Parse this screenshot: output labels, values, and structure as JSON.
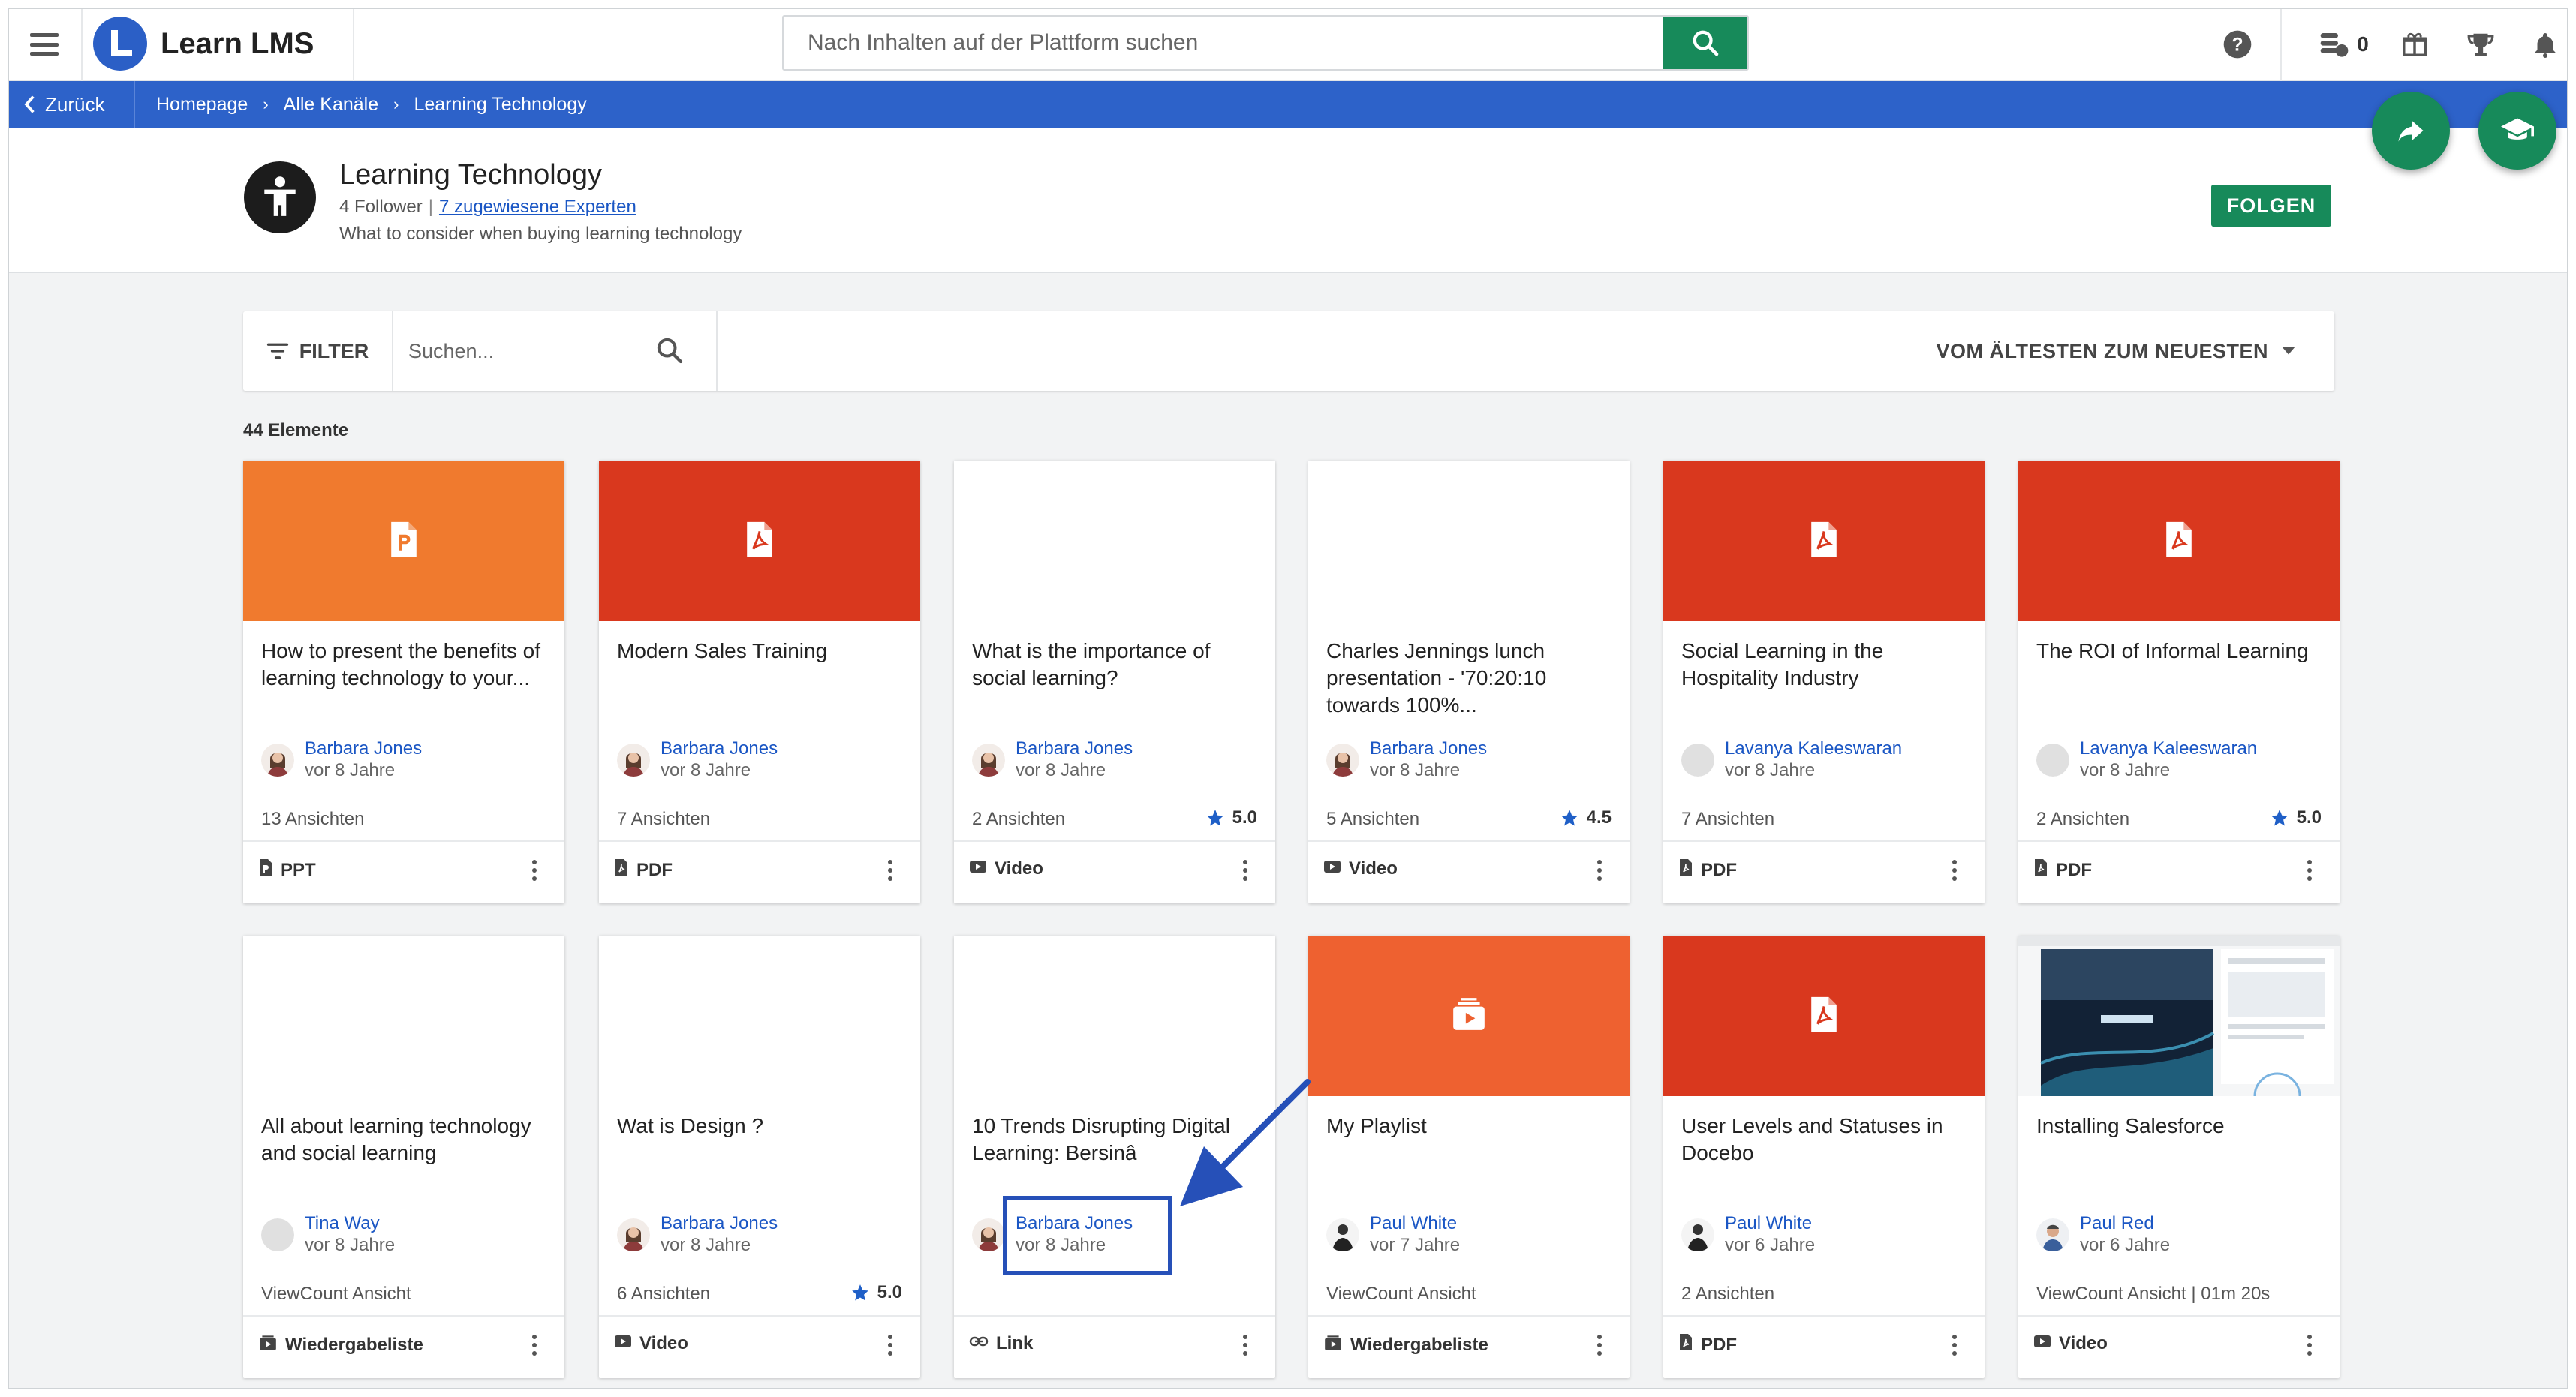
{
  "app": {
    "name": "Learn LMS",
    "brand_color": "#2b5fc6",
    "accent_color": "#178a5a"
  },
  "topbar": {
    "search_placeholder": "Nach Inhalten auf der Plattform suchen",
    "coins_count": "0",
    "icons": [
      "menu-icon",
      "search-icon",
      "help-icon",
      "coins-icon",
      "gift-icon",
      "trophy-icon",
      "bell-icon"
    ]
  },
  "breadcrumb": {
    "back_label": "Zurück",
    "items": [
      "Homepage",
      "Alle Kanäle",
      "Learning Technology"
    ]
  },
  "channel": {
    "title": "Learning Technology",
    "followers": "4 Follower",
    "experts": "7 zugewiesene Experten",
    "description": "What to consider when buying learning technology",
    "follow_label": "FOLGEN"
  },
  "toolbar": {
    "filter_label": "FILTER",
    "search_placeholder": "Suchen...",
    "sort_label": "VOM ÄLTESTEN ZUM NEUESTEN"
  },
  "count_label": "44 Elemente",
  "cards": [
    {
      "title": "How to present the benefits of learning technology to your...",
      "author": "Barbara Jones",
      "date": "vor 8 Jahre",
      "views": "13 Ansichten",
      "rating": "",
      "type": "PPT",
      "thumb": "ppt",
      "color": "#f07a2e"
    },
    {
      "title": "Modern Sales Training",
      "author": "Barbara Jones",
      "date": "vor 8 Jahre",
      "views": "7 Ansichten",
      "rating": "",
      "type": "PDF",
      "thumb": "pdf",
      "color": "#d9381e"
    },
    {
      "title": "What is the importance of social learning?",
      "author": "Barbara Jones",
      "date": "vor 8 Jahre",
      "views": "2 Ansichten",
      "rating": "5.0",
      "type": "Video",
      "thumb": "blank",
      "color": "#ffffff"
    },
    {
      "title": "Charles Jennings lunch presentation - '70:20:10 towards 100%...",
      "author": "Barbara Jones",
      "date": "vor 8 Jahre",
      "views": "5 Ansichten",
      "rating": "4.5",
      "type": "Video",
      "thumb": "blank",
      "color": "#ffffff"
    },
    {
      "title": "Social Learning in the Hospitality Industry",
      "author": "Lavanya Kaleeswaran",
      "date": "vor 8 Jahre",
      "views": "7 Ansichten",
      "rating": "",
      "type": "PDF",
      "thumb": "pdf",
      "color": "#d9381e"
    },
    {
      "title": "The ROI of Informal Learning",
      "author": "Lavanya Kaleeswaran",
      "date": "vor 8 Jahre",
      "views": "2 Ansichten",
      "rating": "5.0",
      "type": "PDF",
      "thumb": "pdf",
      "color": "#d9381e"
    },
    {
      "title": "All about learning technology and social learning",
      "author": "Tina Way",
      "date": "vor 8 Jahre",
      "views": "ViewCount Ansicht",
      "rating": "",
      "type": "Wiedergabeliste",
      "thumb": "blank",
      "color": "#ffffff"
    },
    {
      "title": "Wat is Design ?",
      "author": "Barbara Jones",
      "date": "vor 8 Jahre",
      "views": "6 Ansichten",
      "rating": "5.0",
      "type": "Video",
      "thumb": "blank",
      "color": "#ffffff"
    },
    {
      "title": "10 Trends Disrupting Digital Learning: Bersinâ",
      "author": "Barbara Jones",
      "date": "vor 8 Jahre",
      "views": "",
      "rating": "",
      "type": "Link",
      "thumb": "blank",
      "color": "#ffffff"
    },
    {
      "title": "My Playlist",
      "author": "Paul White",
      "date": "vor 7 Jahre",
      "views": "ViewCount Ansicht",
      "rating": "",
      "type": "Wiedergabeliste",
      "thumb": "playlist",
      "color": "#ee6130"
    },
    {
      "title": "User Levels and Statuses in Docebo",
      "author": "Paul White",
      "date": "vor 6 Jahre",
      "views": "2 Ansichten",
      "rating": "",
      "type": "PDF",
      "thumb": "pdf",
      "color": "#d9381e"
    },
    {
      "title": "Installing Salesforce",
      "author": "Paul Red",
      "date": "vor 6 Jahre",
      "views": "ViewCount Ansicht  |  01m 20s",
      "rating": "",
      "type": "Video",
      "thumb": "screenshot",
      "color": "#1d3c57"
    }
  ]
}
